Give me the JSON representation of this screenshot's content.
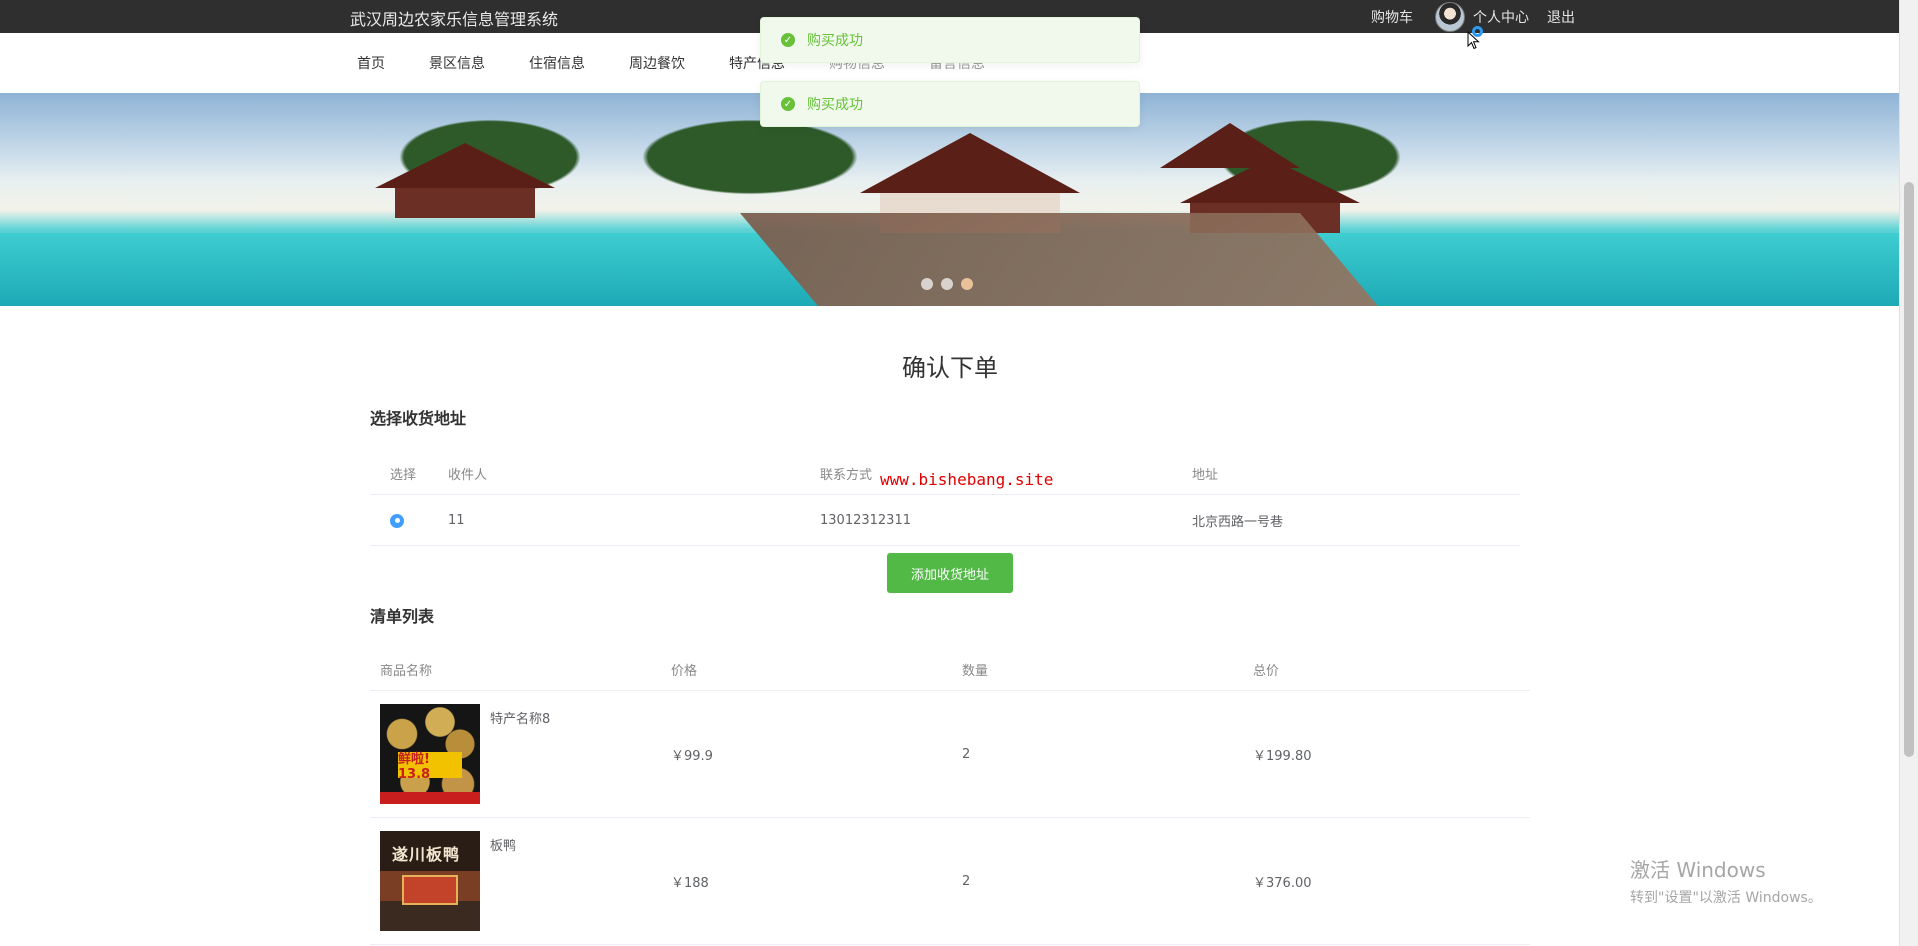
{
  "header": {
    "site_title": "武汉周边农家乐信息管理系统",
    "cart": "购物车",
    "profile": "个人中心",
    "logout": "退出"
  },
  "nav": {
    "items": [
      "首页",
      "景区信息",
      "住宿信息",
      "周边餐饮",
      "特产信息",
      "购物信息",
      "留言信息"
    ]
  },
  "toasts": [
    "购买成功",
    "购买成功"
  ],
  "banner": {
    "slides": 3,
    "active_slide": 3
  },
  "page": {
    "title": "确认下单"
  },
  "address_section": {
    "title": "选择收货地址",
    "columns": [
      "选择",
      "收件人",
      "联系方式",
      "地址"
    ],
    "rows": [
      {
        "selected": true,
        "name": "11",
        "phone": "13012312311",
        "address": "北京西路一号巷"
      }
    ],
    "add_button": "添加收货地址"
  },
  "watermark": "www.bishebang.site",
  "order_section": {
    "title": "清单列表",
    "columns": [
      "商品名称",
      "价格",
      "数量",
      "总价"
    ],
    "rows": [
      {
        "name": "特产名称8",
        "price": "￥99.9",
        "qty": "2",
        "total": "￥199.80",
        "thumb_text": "鲜啦! 13.8"
      },
      {
        "name": "板鸭",
        "price": "￥188",
        "qty": "2",
        "total": "￥376.00",
        "thumb_text": "遂川板鸭"
      }
    ]
  },
  "windows_activation": {
    "line1": "激活 Windows",
    "line2": "转到\"设置\"以激活 Windows。"
  },
  "colors": {
    "topbar": "#2f2f2f",
    "success": "#67c23a",
    "primary_button": "#52b947",
    "radio": "#409eff",
    "watermark": "#e00000"
  },
  "icons": [
    "success-check-icon",
    "avatar",
    "cursor-arrow-icon"
  ]
}
